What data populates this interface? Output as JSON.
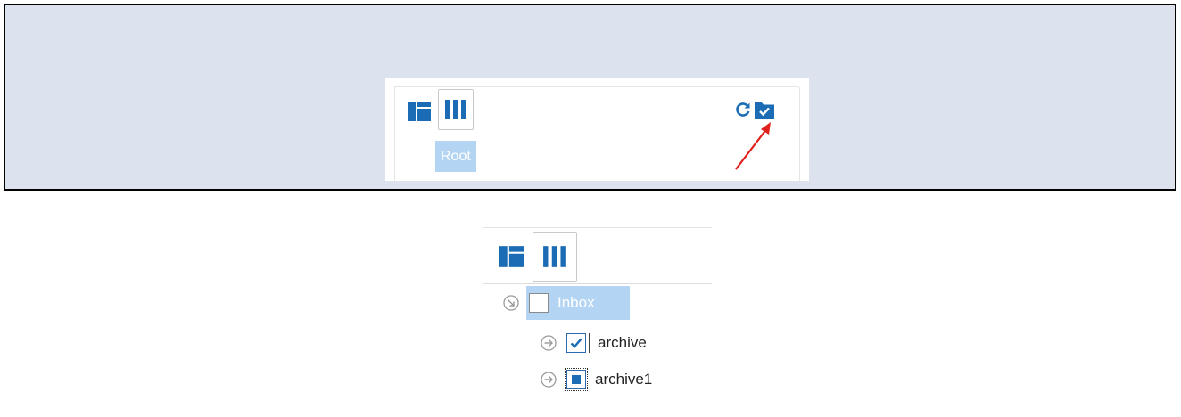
{
  "top_panel": {
    "root_label": "Root",
    "view_buttons": [
      {
        "name": "tree-view",
        "icon": "layout-tree-icon",
        "active": false
      },
      {
        "name": "columns-view",
        "icon": "columns-icon",
        "active": true
      }
    ],
    "actions": [
      {
        "name": "refresh",
        "icon": "refresh-icon"
      },
      {
        "name": "select-folder",
        "icon": "folder-check-icon"
      }
    ],
    "annotation": {
      "type": "arrow",
      "color": "#e0201b",
      "points_to": "folder-check-icon"
    }
  },
  "bottom_panel": {
    "view_buttons": [
      {
        "name": "tree-view",
        "icon": "layout-tree-icon",
        "active": false
      },
      {
        "name": "columns-view",
        "icon": "columns-icon",
        "active": true
      }
    ],
    "tree": [
      {
        "label": "Inbox",
        "state": "unchecked",
        "expander": "collapse-icon",
        "selected": true
      },
      {
        "label": "archive",
        "state": "checked",
        "expander": "expand-icon",
        "selected": false
      },
      {
        "label": "archive1",
        "state": "indeterminate",
        "expander": "expand-icon",
        "selected": false
      }
    ]
  },
  "colors": {
    "accent": "#1b6cb5",
    "highlight": "#b3d4f2",
    "panel_bg": "#dce3ef",
    "annotation": "#e0201b"
  }
}
